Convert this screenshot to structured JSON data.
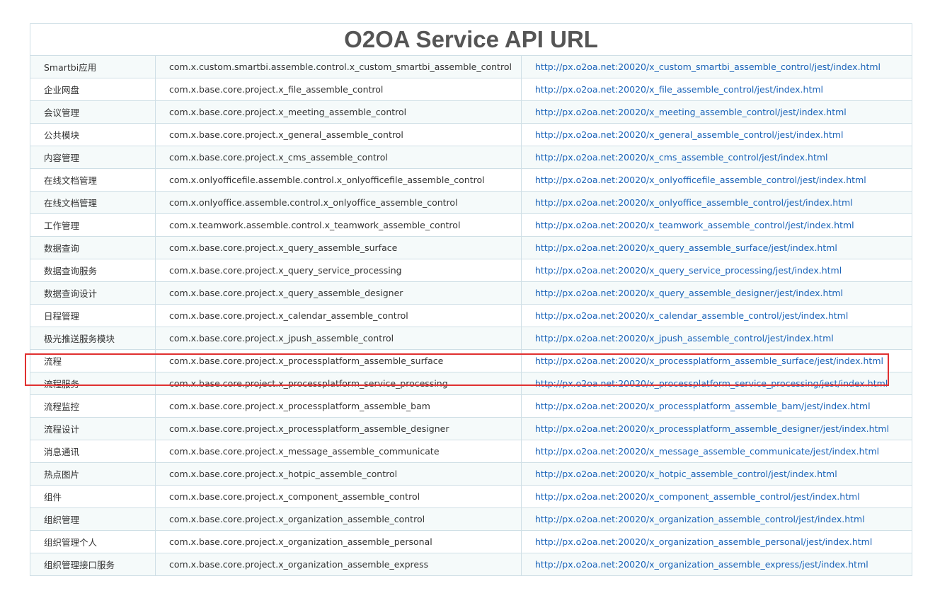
{
  "page": {
    "title": "O2OA Service API URL"
  },
  "rows": [
    {
      "name": "Smartbi应用",
      "module": "com.x.custom.smartbi.assemble.control.x_custom_smartbi_assemble_control",
      "url": "http://px.o2oa.net:20020/x_custom_smartbi_assemble_control/jest/index.html"
    },
    {
      "name": "企业网盘",
      "module": "com.x.base.core.project.x_file_assemble_control",
      "url": "http://px.o2oa.net:20020/x_file_assemble_control/jest/index.html"
    },
    {
      "name": "会议管理",
      "module": "com.x.base.core.project.x_meeting_assemble_control",
      "url": "http://px.o2oa.net:20020/x_meeting_assemble_control/jest/index.html"
    },
    {
      "name": "公共模块",
      "module": "com.x.base.core.project.x_general_assemble_control",
      "url": "http://px.o2oa.net:20020/x_general_assemble_control/jest/index.html"
    },
    {
      "name": "内容管理",
      "module": "com.x.base.core.project.x_cms_assemble_control",
      "url": "http://px.o2oa.net:20020/x_cms_assemble_control/jest/index.html"
    },
    {
      "name": "在线文档管理",
      "module": "com.x.onlyofficefile.assemble.control.x_onlyofficefile_assemble_control",
      "url": "http://px.o2oa.net:20020/x_onlyofficefile_assemble_control/jest/index.html"
    },
    {
      "name": "在线文档管理",
      "module": "com.x.onlyoffice.assemble.control.x_onlyoffice_assemble_control",
      "url": "http://px.o2oa.net:20020/x_onlyoffice_assemble_control/jest/index.html"
    },
    {
      "name": "工作管理",
      "module": "com.x.teamwork.assemble.control.x_teamwork_assemble_control",
      "url": "http://px.o2oa.net:20020/x_teamwork_assemble_control/jest/index.html"
    },
    {
      "name": "数据查询",
      "module": "com.x.base.core.project.x_query_assemble_surface",
      "url": "http://px.o2oa.net:20020/x_query_assemble_surface/jest/index.html"
    },
    {
      "name": "数据查询服务",
      "module": "com.x.base.core.project.x_query_service_processing",
      "url": "http://px.o2oa.net:20020/x_query_service_processing/jest/index.html"
    },
    {
      "name": "数据查询设计",
      "module": "com.x.base.core.project.x_query_assemble_designer",
      "url": "http://px.o2oa.net:20020/x_query_assemble_designer/jest/index.html"
    },
    {
      "name": "日程管理",
      "module": "com.x.base.core.project.x_calendar_assemble_control",
      "url": "http://px.o2oa.net:20020/x_calendar_assemble_control/jest/index.html"
    },
    {
      "name": "极光推送服务模块",
      "module": "com.x.base.core.project.x_jpush_assemble_control",
      "url": "http://px.o2oa.net:20020/x_jpush_assemble_control/jest/index.html"
    },
    {
      "name": "流程",
      "module": "com.x.base.core.project.x_processplatform_assemble_surface",
      "url": "http://px.o2oa.net:20020/x_processplatform_assemble_surface/jest/index.html"
    },
    {
      "name": "流程服务",
      "module": "com.x.base.core.project.x_processplatform_service_processing",
      "url": "http://px.o2oa.net:20020/x_processplatform_service_processing/jest/index.html"
    },
    {
      "name": "流程监控",
      "module": "com.x.base.core.project.x_processplatform_assemble_bam",
      "url": "http://px.o2oa.net:20020/x_processplatform_assemble_bam/jest/index.html"
    },
    {
      "name": "流程设计",
      "module": "com.x.base.core.project.x_processplatform_assemble_designer",
      "url": "http://px.o2oa.net:20020/x_processplatform_assemble_designer/jest/index.html"
    },
    {
      "name": "消息通讯",
      "module": "com.x.base.core.project.x_message_assemble_communicate",
      "url": "http://px.o2oa.net:20020/x_message_assemble_communicate/jest/index.html"
    },
    {
      "name": "热点图片",
      "module": "com.x.base.core.project.x_hotpic_assemble_control",
      "url": "http://px.o2oa.net:20020/x_hotpic_assemble_control/jest/index.html"
    },
    {
      "name": "组件",
      "module": "com.x.base.core.project.x_component_assemble_control",
      "url": "http://px.o2oa.net:20020/x_component_assemble_control/jest/index.html"
    },
    {
      "name": "组织管理",
      "module": "com.x.base.core.project.x_organization_assemble_control",
      "url": "http://px.o2oa.net:20020/x_organization_assemble_control/jest/index.html"
    },
    {
      "name": "组织管理个人",
      "module": "com.x.base.core.project.x_organization_assemble_personal",
      "url": "http://px.o2oa.net:20020/x_organization_assemble_personal/jest/index.html"
    },
    {
      "name": "组织管理接口服务",
      "module": "com.x.base.core.project.x_organization_assemble_express",
      "url": "http://px.o2oa.net:20020/x_organization_assemble_express/jest/index.html"
    }
  ],
  "colors": {
    "link": "#1a63b8",
    "highlight": "#e03030",
    "stripe": "#f5fafa",
    "border": "#cfdfe6"
  }
}
